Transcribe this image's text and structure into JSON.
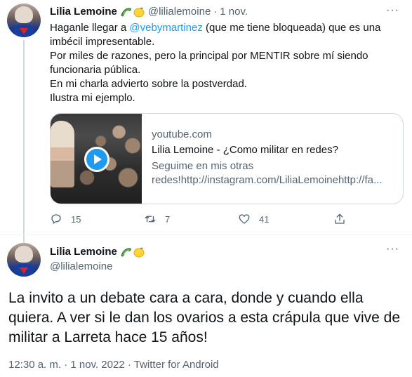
{
  "tweet1": {
    "author_name": "Lilia Lemoine",
    "author_handle": "@lilialemoine",
    "date": "1 nov.",
    "more": "···",
    "badge_icons": [
      "cucumber-emoji-icon",
      "lemon-emoji-icon"
    ],
    "body": {
      "line1_prefix": "Haganle llegar a ",
      "mention": "@vebymartinez",
      "line1_suffix": " (que me tiene bloqueada) que es una imbécil impresentable.",
      "line2": "Por miles de razones, pero la principal por MENTIR sobre mí siendo funcionaria pública.",
      "line3": "En mi charla advierto sobre la postverdad.",
      "line4": "Ilustra mi ejemplo."
    },
    "card": {
      "domain": "youtube.com",
      "title": "Lilia Lemoine - ¿Como militar en redes?",
      "desc_line1": "Seguime en mis otras",
      "desc_line2": "redes!http://instagram.com/LiliaLemoinehttp://fa..."
    },
    "actions": {
      "replies": "15",
      "retweets": "7",
      "likes": "41"
    }
  },
  "tweet2": {
    "author_name": "Lilia Lemoine",
    "author_handle": "@lilialemoine",
    "more": "···",
    "body": "La invito a un debate cara a cara, donde y cuando ella quiera. A ver si le dan los ovarios a esta crápula que vive de militar a Larreta hace 15 años!",
    "time": "12:30 a. m.",
    "date": "1 nov. 2022",
    "source": "Twitter for Android"
  },
  "colors": {
    "accent": "#1d9bf0",
    "text": "#0f1419",
    "secondary": "#536471",
    "border": "#cfd9de"
  }
}
